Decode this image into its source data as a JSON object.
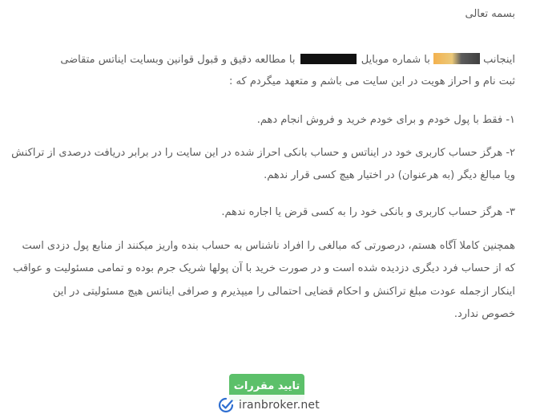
{
  "document": {
    "greeting": "بسمه تعالی",
    "intro_line1_part1": "اینجانب",
    "intro_line1_part2": "با شماره موبایل",
    "intro_line1_part3": "با مطالعه دقیق و قبول قوانین وبسایت ایناتس متقاضی",
    "intro_line2": "ثبت نام و احراز هویت در این سایت می باشم و متعهد میگردم که :",
    "item1": "۱- فقط با پول خودم و برای خودم خرید و فروش انجام دهم.",
    "item2_line1": "۲- هرگز حساب کاربری خود در ایناتس و حساب بانکی احراز شده در این سایت را در برابر دریافت درصدی از تراکنش",
    "item2_line2": "ویا مبالغ دیگر (به هرعنوان) در اختیار هیچ کسی قرار ندهم.",
    "item3": "۳- هرگز حساب کاربری و بانکی خود را به کسی قرض یا اجاره ندهم.",
    "closing_line1": "همچنین کاملا آگاه هستم، درصورتی که مبالغی را افراد ناشناس به حساب بنده واریز میکنند از منابع پول دزدی است",
    "closing_line2": "که از حساب فرد دیگری دزدیده شده است و در صورت خرید با آن پولها شریک جرم بوده و تمامی مسئولیت و عواقب",
    "closing_line3": "اینکار ازجمله عودت مبلغ تراکنش و احکام قضایی احتمالی را میپذیرم و صرافی ایناتس هیچ مسئولیتی در این",
    "closing_line4": "خصوص ندارد."
  },
  "confirm_button": {
    "label": "تایید مقررات"
  },
  "watermark": {
    "text": "iranbroker.net",
    "icon": "checkmark-logo-icon",
    "color": "#2f6fd1"
  },
  "colors": {
    "text": "#5b5b5b",
    "button": "#5cc06a",
    "redaction": "#111111"
  }
}
